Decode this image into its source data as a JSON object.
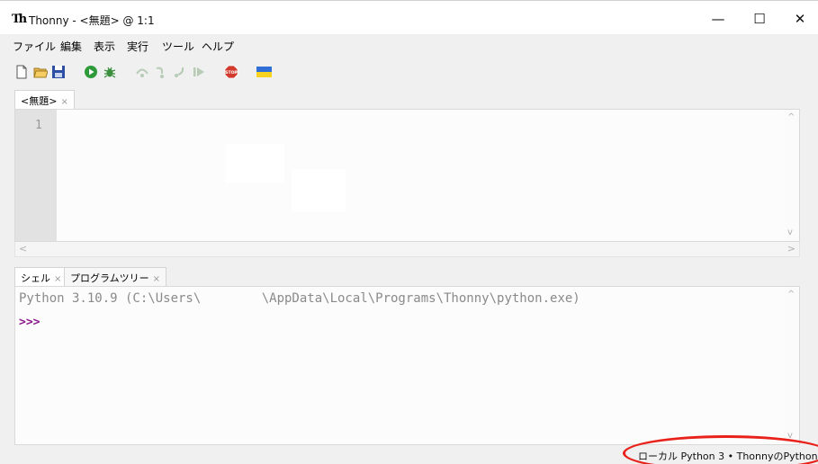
{
  "window": {
    "logo": "Th",
    "title": "Thonny - <無題> @ 1:1",
    "minimize": "—",
    "maximize": "☐",
    "close": "✕"
  },
  "menu": [
    "ファイル",
    "編集",
    "表示",
    "実行",
    "ツール",
    "ヘルプ"
  ],
  "toolbar": {
    "icons": [
      "new-file-icon",
      "open-folder-icon",
      "save-icon",
      "run-icon",
      "debug-icon",
      "step-over-icon",
      "step-into-icon",
      "step-out-icon",
      "resume-icon",
      "stop-icon",
      "ukraine-flag-icon"
    ],
    "colors": {
      "run": "#2e9a3a",
      "stop": "#d23a2e",
      "flag_blue": "#2f6fd6",
      "flag_yellow": "#f7d21e"
    }
  },
  "editor": {
    "tab_label": "<無題>",
    "tab_close": "×",
    "line_number": "1"
  },
  "scrollbars": {
    "up": "^",
    "down": "v",
    "left": "<",
    "right": ">"
  },
  "shell_panel": {
    "tabs": [
      {
        "label": "シェル",
        "close": "×"
      },
      {
        "label": "プログラムツリー",
        "close": "×"
      }
    ],
    "output": "Python 3.10.9 (C:\\Users\\        \\AppData\\Local\\Programs\\Thonny\\python.exe)",
    "prompt": ">>>"
  },
  "statusbar": {
    "interpreter": "ローカル Python 3 • ThonnyのPython"
  }
}
